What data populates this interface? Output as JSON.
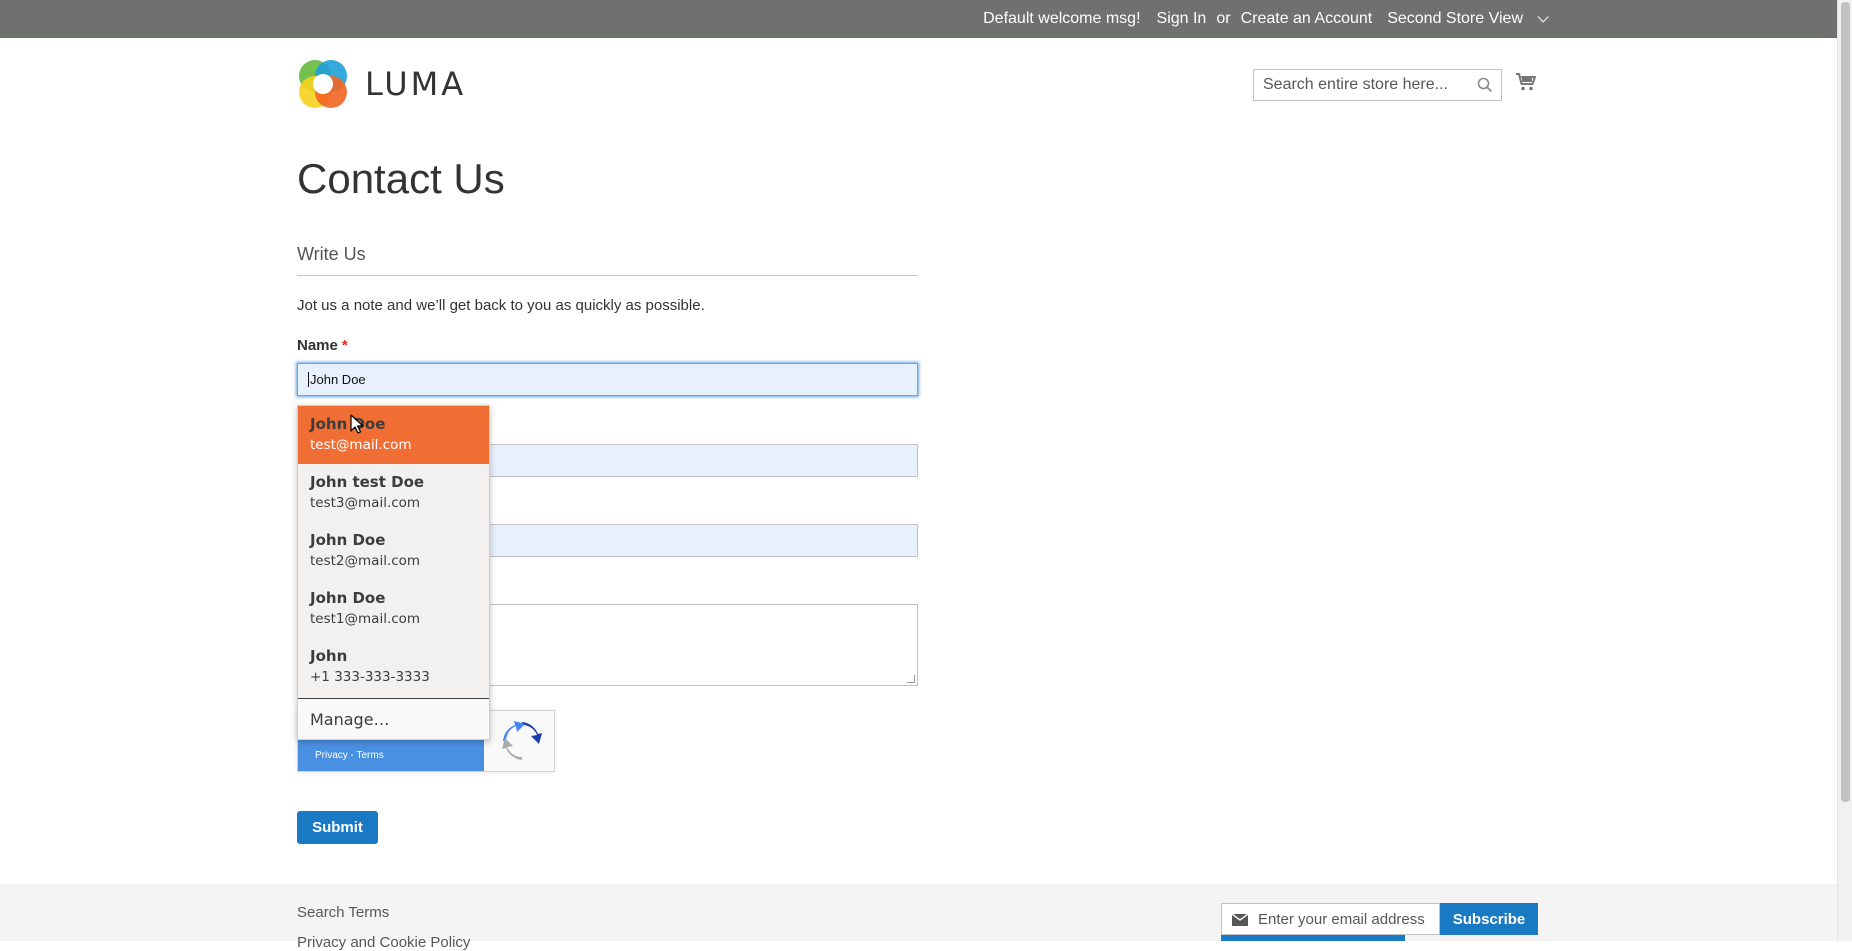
{
  "header": {
    "welcome": "Default welcome msg!",
    "sign_in": "Sign In",
    "or": "or",
    "create_account": "Create an Account",
    "store_view": "Second Store View"
  },
  "brand": {
    "name": "LUMA"
  },
  "search": {
    "placeholder": "Search entire store here..."
  },
  "page": {
    "title": "Contact Us",
    "legend": "Write Us",
    "note": "Jot us a note and we’ll get back to you as quickly as possible.",
    "name_label": "Name",
    "required_mark": "*",
    "name_value": "John Doe",
    "submit_label": "Submit"
  },
  "autofill": {
    "items": [
      {
        "name": "John Doe",
        "sub": "test@mail.com",
        "active": true
      },
      {
        "name": "John test Doe",
        "sub": "test3@mail.com"
      },
      {
        "name": "John Doe",
        "sub": "test2@mail.com"
      },
      {
        "name": "John Doe",
        "sub": "test1@mail.com"
      },
      {
        "name": "John",
        "sub": "+1 333-333-3333"
      }
    ],
    "manage_label": "Manage…"
  },
  "recaptcha": {
    "links": "Privacy - Terms"
  },
  "footer": {
    "links": [
      "Search Terms",
      "Privacy and Cookie Policy"
    ],
    "newsletter_placeholder": "Enter your email address",
    "subscribe_label": "Subscribe"
  },
  "colors": {
    "accent": "#1979c3",
    "autofill_active": "#f06e33",
    "topbar": "#6e716e"
  }
}
